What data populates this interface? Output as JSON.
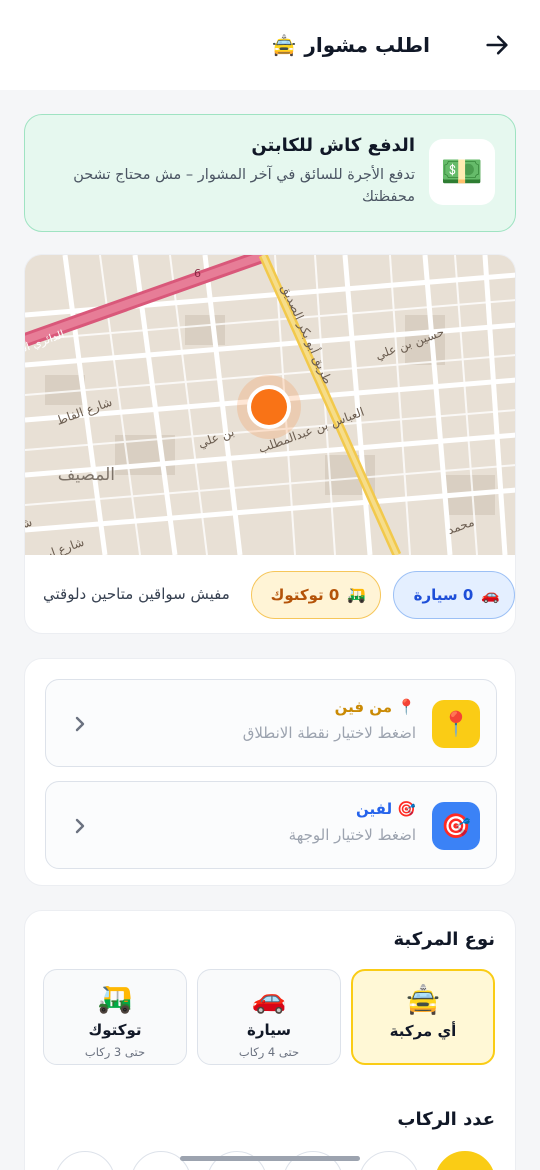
{
  "header": {
    "title": "اطلب مشوار",
    "title_icon": "🚖",
    "back_icon": "arrow-right-icon"
  },
  "cash": {
    "icon": "💵",
    "title": "الدفع كاش للكابتن",
    "desc": "تدفع الأجرة للسائق في آخر المشوار – مش محتاج تشحن محفظتك"
  },
  "map": {
    "labels": [
      "6",
      "الدائري الشمالي",
      "شارع الفاط",
      "المصيف",
      "طريق أبو بكر الصديق",
      "العباس بن عبدالمطلب",
      "حسين بن علي",
      "شارع عبدالله بن حسين",
      "شارع ابن سينا",
      "بن علي",
      "محمد"
    ]
  },
  "availability": {
    "car": {
      "icon": "🚗",
      "label": "0 سيارة"
    },
    "tuk": {
      "icon": "🛺",
      "label": "0 توكتوك"
    },
    "status": "مفيش سواقين متاحين دلوقتي"
  },
  "location": {
    "from": {
      "icon": "📍",
      "label": "📍 من فين",
      "hint": "اضغط لاختيار نقطة الانطلاق"
    },
    "to": {
      "icon": "🎯",
      "label": "🎯 لفين",
      "hint": "اضغط لاختيار الوجهة"
    }
  },
  "vehicle": {
    "title": "نوع المركبة",
    "options": [
      {
        "emoji": "🚖",
        "name": "أي مركبة",
        "cap": ""
      },
      {
        "emoji": "🚗",
        "name": "سيارة",
        "cap": "حتى 4 ركاب"
      },
      {
        "emoji": "🛺",
        "name": "توكتوك",
        "cap": "حتى 3 ركاب"
      }
    ],
    "accent": "#facc15"
  },
  "passengers": {
    "title": "عدد الركاب"
  }
}
